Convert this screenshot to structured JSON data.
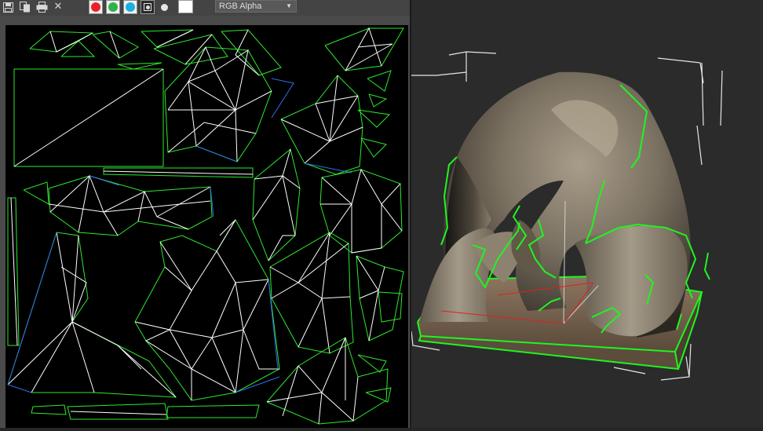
{
  "toolbar": {
    "buttons": [
      {
        "icon": "save-icon"
      },
      {
        "icon": "copy-icon"
      },
      {
        "icon": "print-icon"
      },
      {
        "icon": "close-icon",
        "glyph": "✕"
      }
    ],
    "channels": [
      {
        "icon": "red-channel-icon",
        "color": "#e8202a"
      },
      {
        "icon": "green-channel-icon",
        "color": "#2db34a"
      },
      {
        "icon": "blue-channel-icon",
        "color": "#1ab0e0"
      },
      {
        "icon": "alpha-channel-icon"
      },
      {
        "icon": "mono-channel-icon"
      }
    ],
    "swatch_color": "#ffffff",
    "channel_select": {
      "value": "RGB Alpha"
    }
  },
  "colors": {
    "uv_green": "#2ee82e",
    "uv_white": "#ffffff",
    "uv_blue": "#2f6fe8",
    "viewport_bg": "#2b2b2b",
    "selection_green": "#1ff51f",
    "bbox_white": "#e6e6e6"
  }
}
